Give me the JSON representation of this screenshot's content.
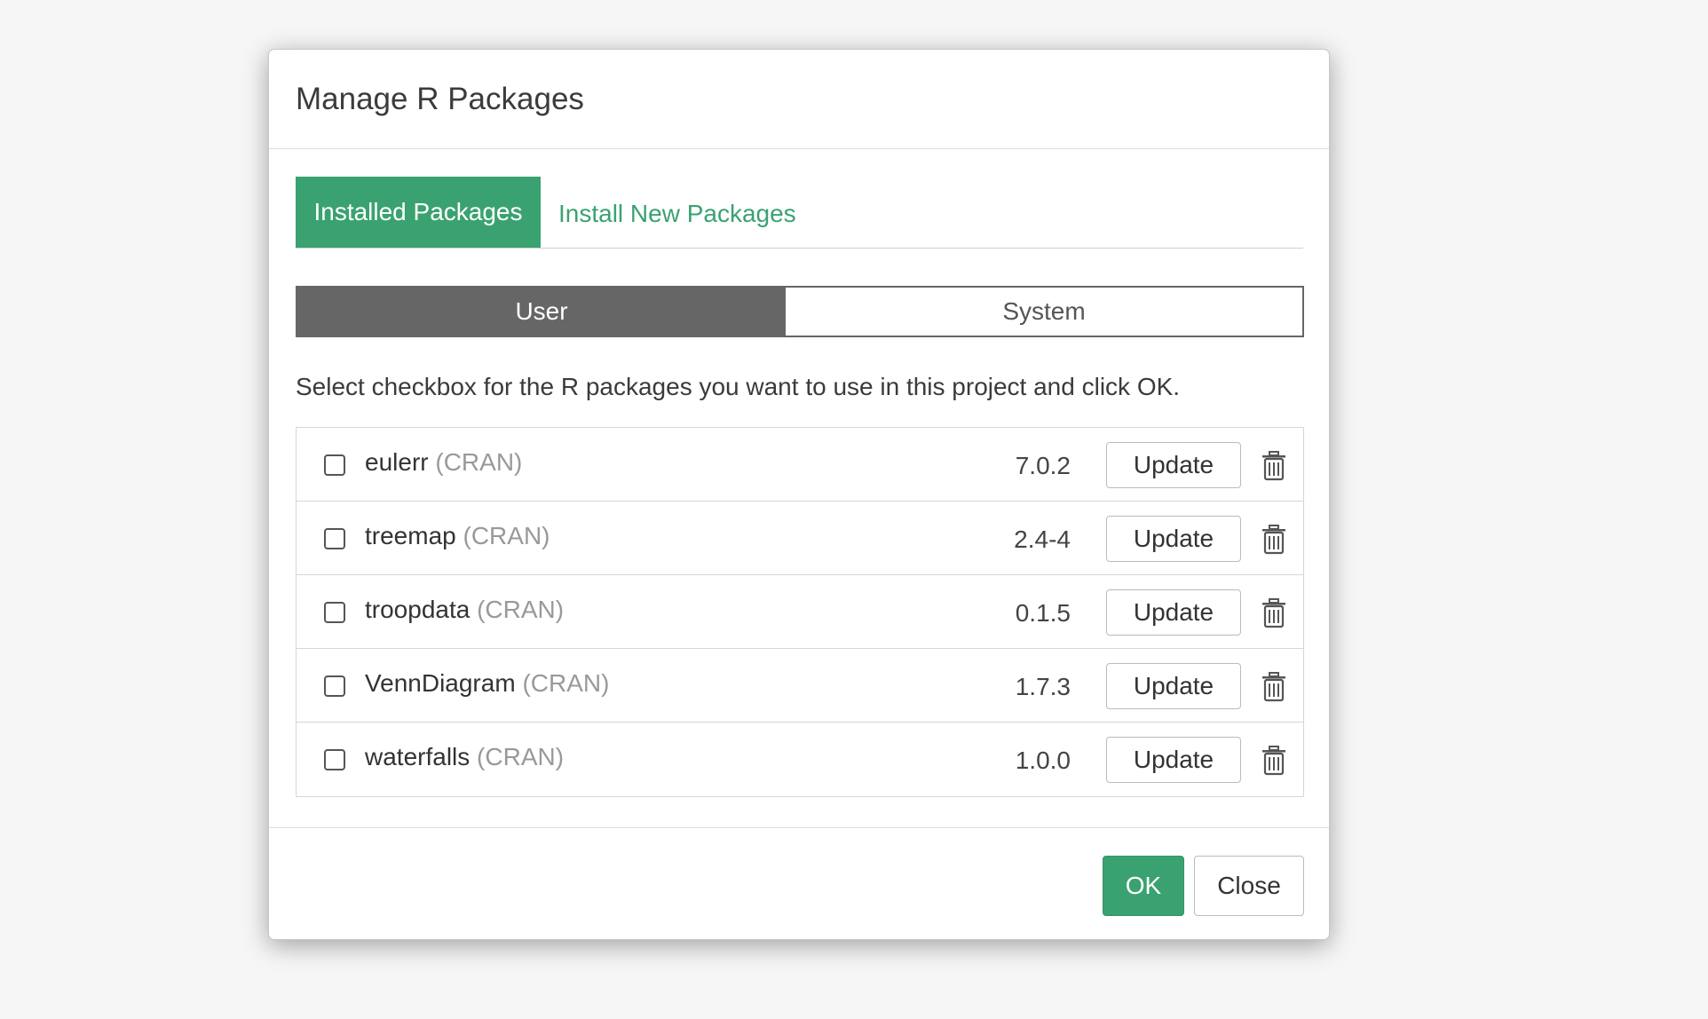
{
  "dialog": {
    "title": "Manage R Packages"
  },
  "tabs": [
    {
      "label": "Installed Packages",
      "active": true
    },
    {
      "label": "Install New Packages",
      "active": false
    }
  ],
  "library_toggle": {
    "options": [
      "User",
      "System"
    ],
    "selected": "User"
  },
  "instructions": "Select checkbox for the R packages you want to use in this project and click OK.",
  "packages": [
    {
      "name": "eulerr",
      "source": "(CRAN)",
      "version": "7.0.2",
      "checked": false,
      "update_label": "Update"
    },
    {
      "name": "treemap",
      "source": "(CRAN)",
      "version": "2.4-4",
      "checked": false,
      "update_label": "Update"
    },
    {
      "name": "troopdata",
      "source": "(CRAN)",
      "version": "0.1.5",
      "checked": false,
      "update_label": "Update"
    },
    {
      "name": "VennDiagram",
      "source": "(CRAN)",
      "version": "1.7.3",
      "checked": false,
      "update_label": "Update"
    },
    {
      "name": "waterfalls",
      "source": "(CRAN)",
      "version": "1.0.0",
      "checked": false,
      "update_label": "Update"
    }
  ],
  "footer": {
    "ok_label": "OK",
    "close_label": "Close"
  },
  "icons": {
    "delete": "trash-icon"
  },
  "colors": {
    "accent": "#3aa271",
    "toggle_active": "#666666",
    "muted_text": "#999999"
  }
}
